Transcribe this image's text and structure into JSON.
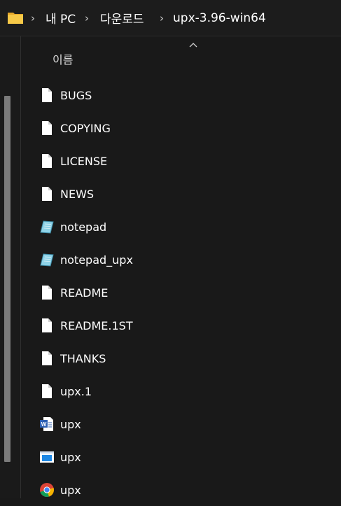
{
  "breadcrumb": {
    "items": [
      "내 PC",
      "다운로드",
      "upx-3.96-win64"
    ],
    "separator": "›"
  },
  "column": {
    "name_label": "이름"
  },
  "files": [
    {
      "name": "BUGS",
      "icon": "document-icon"
    },
    {
      "name": "COPYING",
      "icon": "document-icon"
    },
    {
      "name": "LICENSE",
      "icon": "document-icon"
    },
    {
      "name": "NEWS",
      "icon": "document-icon"
    },
    {
      "name": "notepad",
      "icon": "notepad-icon"
    },
    {
      "name": "notepad_upx",
      "icon": "notepad-icon"
    },
    {
      "name": "README",
      "icon": "document-icon"
    },
    {
      "name": "README.1ST",
      "icon": "document-icon"
    },
    {
      "name": "THANKS",
      "icon": "document-icon"
    },
    {
      "name": "upx.1",
      "icon": "document-icon"
    },
    {
      "name": "upx",
      "icon": "word-document-icon"
    },
    {
      "name": "upx",
      "icon": "application-window-icon"
    },
    {
      "name": "upx",
      "icon": "chrome-html-icon"
    }
  ],
  "colors": {
    "background": "#191919",
    "text": "#ffffff",
    "folder": "#f5c242",
    "scrollbar": "#7b7b7b"
  }
}
